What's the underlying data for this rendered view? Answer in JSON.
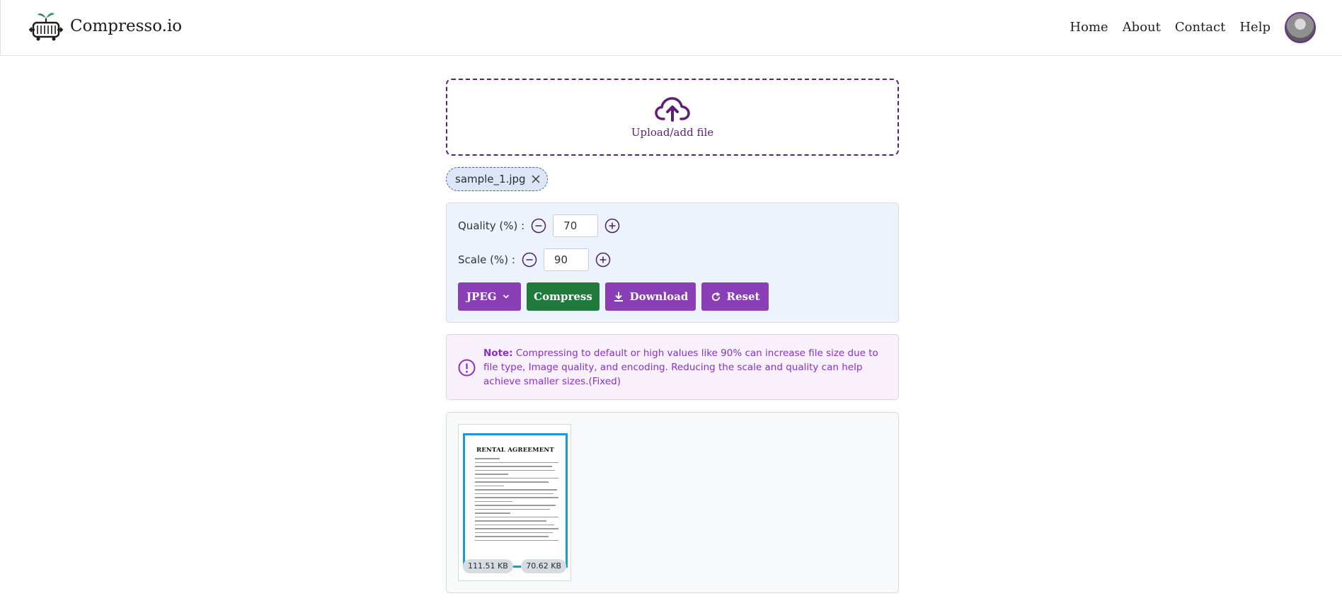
{
  "app": {
    "name": "Compresso.io"
  },
  "nav": {
    "items": [
      {
        "label": "Home"
      },
      {
        "label": "About"
      },
      {
        "label": "Contact"
      },
      {
        "label": "Help"
      }
    ]
  },
  "upload": {
    "label": "Upload/add file"
  },
  "file_chip": {
    "name": "sample_1.jpg"
  },
  "settings": {
    "quality_label": "Quality (%) :",
    "quality_value": "70",
    "scale_label": "Scale (%) :",
    "scale_value": "90",
    "format_selected": "JPEG",
    "compress_label": "Compress",
    "download_label": "Download",
    "reset_label": "Reset"
  },
  "note": {
    "prefix": "Note:",
    "text": " Compressing to default or high values like 90% can increase file size due to file type, Image quality, and encoding. Reducing the scale and quality can help achieve smaller sizes.(Fixed)"
  },
  "preview": {
    "doc_title": "RENTAL AGREEMENT",
    "original_size": "111.51 KB",
    "compressed_size": "70.62 KB"
  },
  "colors": {
    "brand_purple": "#8a3fb7",
    "dark_purple": "#5e1e78",
    "compress_green": "#1f7a3c",
    "settings_bg": "#ecf3fd",
    "note_text": "#8a2fc9",
    "preview_border": "#1a9ad6"
  },
  "icons": {
    "logo": "compress-logo-icon",
    "upload": "cloud-upload-icon",
    "chip_close": "close-icon",
    "minus": "minus-circle-icon",
    "plus": "plus-circle-icon",
    "chevron": "chevron-down-icon",
    "download": "download-icon",
    "reset": "refresh-icon",
    "note": "alert-circle-icon"
  }
}
